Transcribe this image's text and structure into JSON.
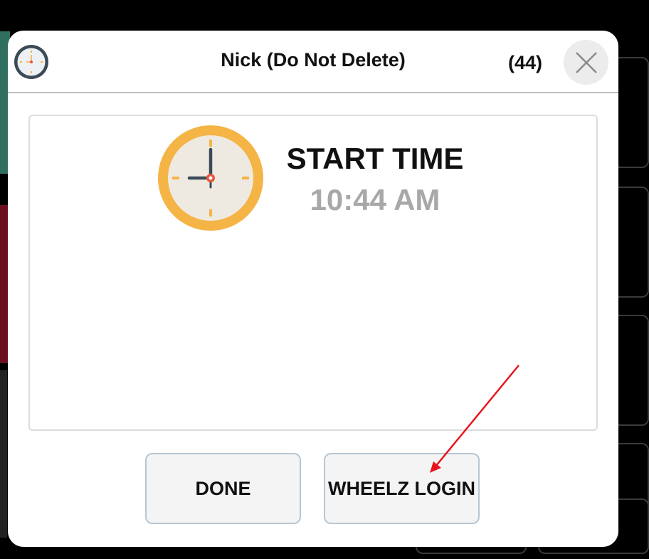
{
  "dialog": {
    "title": "Nick (Do Not Delete)",
    "count": "(44)",
    "close_icon": "close-icon",
    "header_icon": "clock-icon"
  },
  "content": {
    "label": "START TIME",
    "time": "10:44 AM",
    "icon": "clock-icon"
  },
  "buttons": {
    "done": "DONE",
    "wheelz_login": "WHEELZ LOGIN"
  },
  "annotation": {
    "arrow_color": "#e8141c"
  },
  "colors": {
    "clock_face": "#f4b446",
    "clock_inner": "#efeae1",
    "clock_hands": "#3c4a57"
  }
}
